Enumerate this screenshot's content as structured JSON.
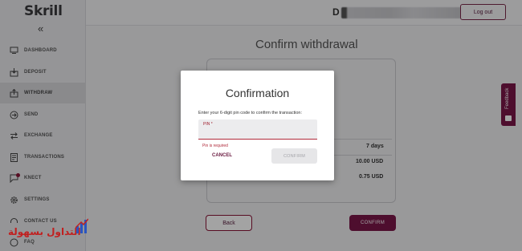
{
  "brand": {
    "logo": "Skrill"
  },
  "sidebar": {
    "collapse_glyph": "«",
    "items": [
      {
        "label": "DASHBOARD",
        "icon": "dashboard-icon"
      },
      {
        "label": "DEPOSIT",
        "icon": "deposit-icon"
      },
      {
        "label": "WITHDRAW",
        "icon": "withdraw-icon",
        "active": true
      },
      {
        "label": "SEND",
        "icon": "send-icon"
      },
      {
        "label": "EXCHANGE",
        "icon": "exchange-icon"
      },
      {
        "label": "TRANSACTIONS",
        "icon": "transactions-icon"
      },
      {
        "label": "KNECT",
        "icon": "knect-icon"
      },
      {
        "label": "SETTINGS",
        "icon": "settings-icon"
      },
      {
        "label": "CONTACT US",
        "icon": "contact-icon"
      },
      {
        "label": "FAQ",
        "icon": "faq-icon"
      }
    ]
  },
  "header": {
    "user_initial": "D",
    "logout_label": "Log out"
  },
  "page": {
    "title": "Confirm withdrawal",
    "rows": [
      {
        "value": "7 days"
      },
      {
        "value": "10.00 USD"
      },
      {
        "value": "0.75 USD"
      }
    ],
    "back_label": "Back",
    "confirm_label": "CONFIRM"
  },
  "modal": {
    "title": "Confirmation",
    "description": "Enter your 6-digit pin code to confirm the transaction:",
    "pin_label": "PIN *",
    "pin_value": "",
    "error": "Pin is required",
    "cancel_label": "CANCEL",
    "confirm_label": "CONFIRM"
  },
  "feedback": {
    "label": "Feedback"
  },
  "watermark": {
    "text": "التداول بسهولة"
  },
  "colors": {
    "brand": "#7a1648",
    "error": "#b02a3a",
    "sidebar_bg": "#e9e9ec"
  }
}
